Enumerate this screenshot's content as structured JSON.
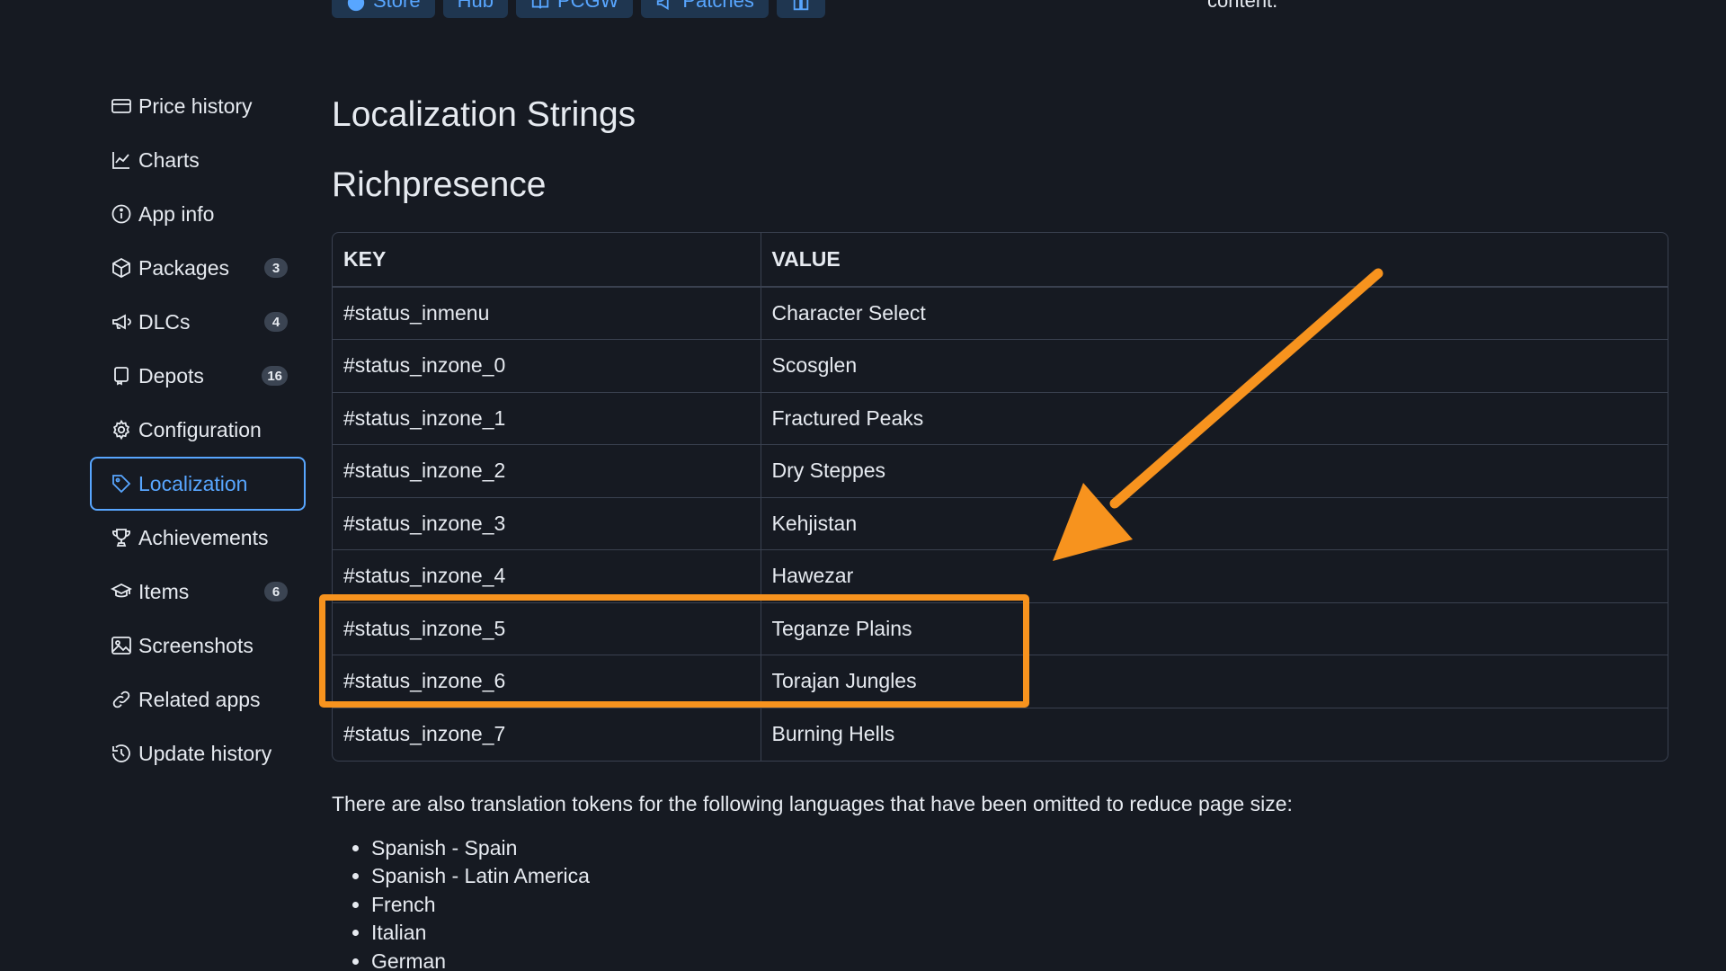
{
  "topbar": {
    "buttons": [
      {
        "label": "Store",
        "icon": "steam-icon"
      },
      {
        "label": "Hub",
        "icon": ""
      },
      {
        "label": "PCGW",
        "icon": "book-icon"
      },
      {
        "label": "Patches",
        "icon": "megaphone-icon"
      },
      {
        "label": "",
        "icon": "grid-icon"
      }
    ],
    "note": "content."
  },
  "sidebar": {
    "items": [
      {
        "label": "Price history",
        "icon": "credit-card-icon"
      },
      {
        "label": "Charts",
        "icon": "graph-icon"
      },
      {
        "label": "App info",
        "icon": "info-icon"
      },
      {
        "label": "Packages",
        "icon": "package-icon",
        "badge": "3"
      },
      {
        "label": "DLCs",
        "icon": "megaphone-icon",
        "badge": "4"
      },
      {
        "label": "Depots",
        "icon": "server-icon",
        "badge": "16"
      },
      {
        "label": "Configuration",
        "icon": "gear-icon"
      },
      {
        "label": "Localization",
        "icon": "tag-icon",
        "active": true
      },
      {
        "label": "Achievements",
        "icon": "trophy-icon"
      },
      {
        "label": "Items",
        "icon": "mortar-board-icon",
        "badge": "6"
      },
      {
        "label": "Screenshots",
        "icon": "image-icon"
      },
      {
        "label": "Related apps",
        "icon": "link-icon"
      },
      {
        "label": "Update history",
        "icon": "history-icon"
      }
    ]
  },
  "main": {
    "title": "Localization Strings",
    "section": "Richpresence",
    "table": {
      "headers": [
        "KEY",
        "VALUE"
      ],
      "rows": [
        [
          "#status_inmenu",
          "Character Select"
        ],
        [
          "#status_inzone_0",
          "Scosglen"
        ],
        [
          "#status_inzone_1",
          "Fractured Peaks"
        ],
        [
          "#status_inzone_2",
          "Dry Steppes"
        ],
        [
          "#status_inzone_3",
          "Kehjistan"
        ],
        [
          "#status_inzone_4",
          "Hawezar"
        ],
        [
          "#status_inzone_5",
          "Teganze Plains"
        ],
        [
          "#status_inzone_6",
          "Torajan Jungles"
        ],
        [
          "#status_inzone_7",
          "Burning Hells"
        ]
      ]
    },
    "note": "There are also translation tokens for the following languages that have been omitted to reduce page size:",
    "languages": [
      "Spanish - Spain",
      "Spanish - Latin America",
      "French",
      "Italian",
      "German"
    ]
  },
  "colors": {
    "background": "#161a22",
    "accent": "#58a6ff",
    "annotation": "#f7931e",
    "border": "#3a4150"
  }
}
